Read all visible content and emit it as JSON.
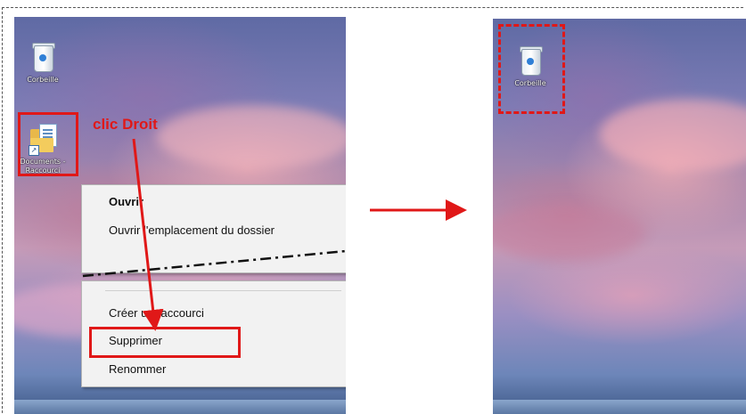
{
  "left_panel": {
    "desktop_icons": {
      "recycle_bin_label": "Corbeille",
      "documents_label_line1": "Documents -",
      "documents_label_line2": "Raccourci"
    },
    "annotation": "clic Droit",
    "context_menu": {
      "items": [
        "Ouvrir",
        "Ouvrir l'emplacement du dossier",
        "Créer un raccourci",
        "Supprimer",
        "Renommer"
      ]
    }
  },
  "right_panel": {
    "recycle_bin_label": "Corbeille"
  },
  "colors": {
    "annotation_red": "#e01818",
    "menu_bg": "#f2f2f2"
  },
  "icons": [
    "recycle-bin-icon",
    "folder-shortcut-icon",
    "arrow-right-icon"
  ]
}
